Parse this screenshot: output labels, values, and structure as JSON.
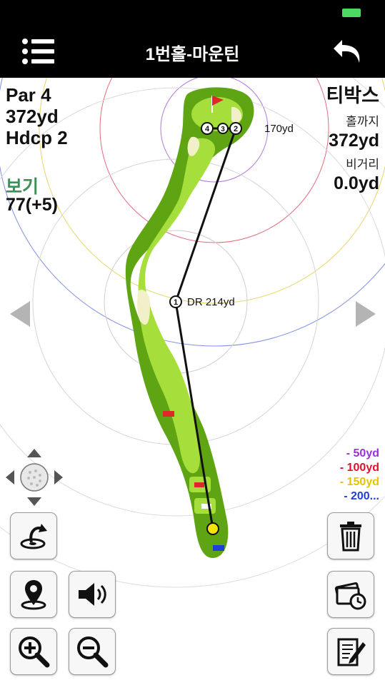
{
  "status": {
    "battery_color": "#4cd964"
  },
  "header": {
    "title": "1번홀-마운틴",
    "menu_icon": "list-icon",
    "back_icon": "undo-arrow-icon"
  },
  "hole": {
    "par": "Par 4",
    "length": "372yd",
    "handicap": "Hdcp 2"
  },
  "score": {
    "label": "보기",
    "value": "77(+5)"
  },
  "tee": {
    "name": "티박스",
    "to_hole_label": "홀까지",
    "to_hole_value": "372yd",
    "carry_label": "비거리",
    "carry_value": "0.0yd"
  },
  "shots": [
    {
      "number": "1",
      "label": "DR 214yd"
    },
    {
      "number": "2",
      "label": "170yd"
    },
    {
      "number": "3",
      "label": ""
    },
    {
      "number": "4",
      "label": ""
    }
  ],
  "legend": [
    {
      "text": "- 50yd",
      "color": "#9b30d9"
    },
    {
      "text": "- 100yd",
      "color": "#e0102f"
    },
    {
      "text": "- 150yd",
      "color": "#e8c200"
    },
    {
      "text": "- 200...",
      "color": "#1f3fd6"
    }
  ],
  "colors": {
    "green": "#7cc520",
    "rough": "#5fa513",
    "fairway": "#a6de3c",
    "bunker": "#f2f0c8",
    "topbar": "#000000"
  },
  "buttons": [
    "ball-move-icon",
    "reset-view-icon",
    "location-pin-icon",
    "speaker-icon",
    "zoom-in-icon",
    "zoom-out-icon",
    "trash-icon",
    "card-clock-icon",
    "notepad-icon"
  ]
}
